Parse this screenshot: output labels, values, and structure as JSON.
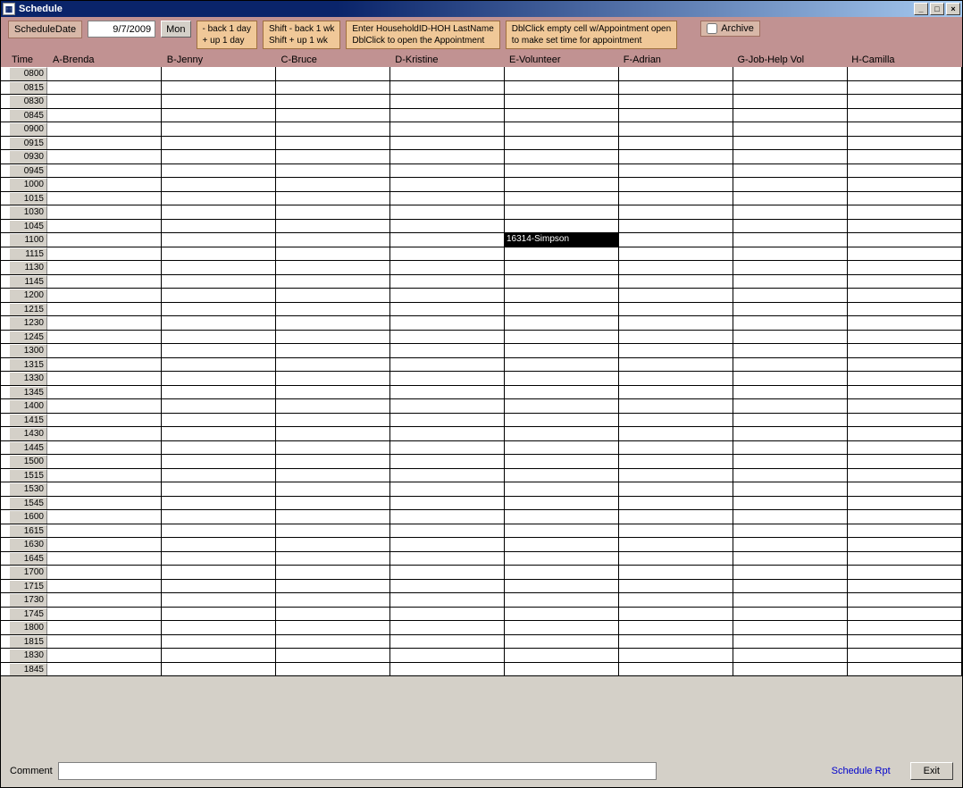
{
  "window": {
    "title": "Schedule"
  },
  "toolbar": {
    "date_label": "ScheduleDate",
    "date_value": "9/7/2009",
    "day_btn": "Mon",
    "help1_line1": "- back 1 day",
    "help1_line2": "+ up 1 day",
    "help2_line1": "Shift - back 1 wk",
    "help2_line2": "Shift + up 1 wk",
    "help3_line1": "Enter HouseholdID-HOH LastName",
    "help3_line2": "DblClick to open the Appointment",
    "help4_line1": "DblClick empty cell w/Appointment open",
    "help4_line2": "to make set time for appointment",
    "archive_label": "Archive"
  },
  "columns": {
    "time": "Time",
    "a": "A-Brenda",
    "b": "B-Jenny",
    "c": "C-Bruce",
    "d": "D-Kristine",
    "e": "E-Volunteer",
    "f": "F-Adrian",
    "g": "G-Job-Help Vol",
    "h": "H-Camilla"
  },
  "times": [
    "0800",
    "0815",
    "0830",
    "0845",
    "0900",
    "0915",
    "0930",
    "0945",
    "1000",
    "1015",
    "1030",
    "1045",
    "1100",
    "1115",
    "1130",
    "1145",
    "1200",
    "1215",
    "1230",
    "1245",
    "1300",
    "1315",
    "1330",
    "1345",
    "1400",
    "1415",
    "1430",
    "1445",
    "1500",
    "1515",
    "1530",
    "1545",
    "1600",
    "1615",
    "1630",
    "1645",
    "1700",
    "1715",
    "1730",
    "1745",
    "1800",
    "1815",
    "1830",
    "1845"
  ],
  "appointments": {
    "1100": {
      "e": "16314-Simpson"
    }
  },
  "bottom": {
    "comment_label": "Comment",
    "comment_value": "",
    "schedule_rpt": "Schedule Rpt",
    "exit": "Exit"
  }
}
